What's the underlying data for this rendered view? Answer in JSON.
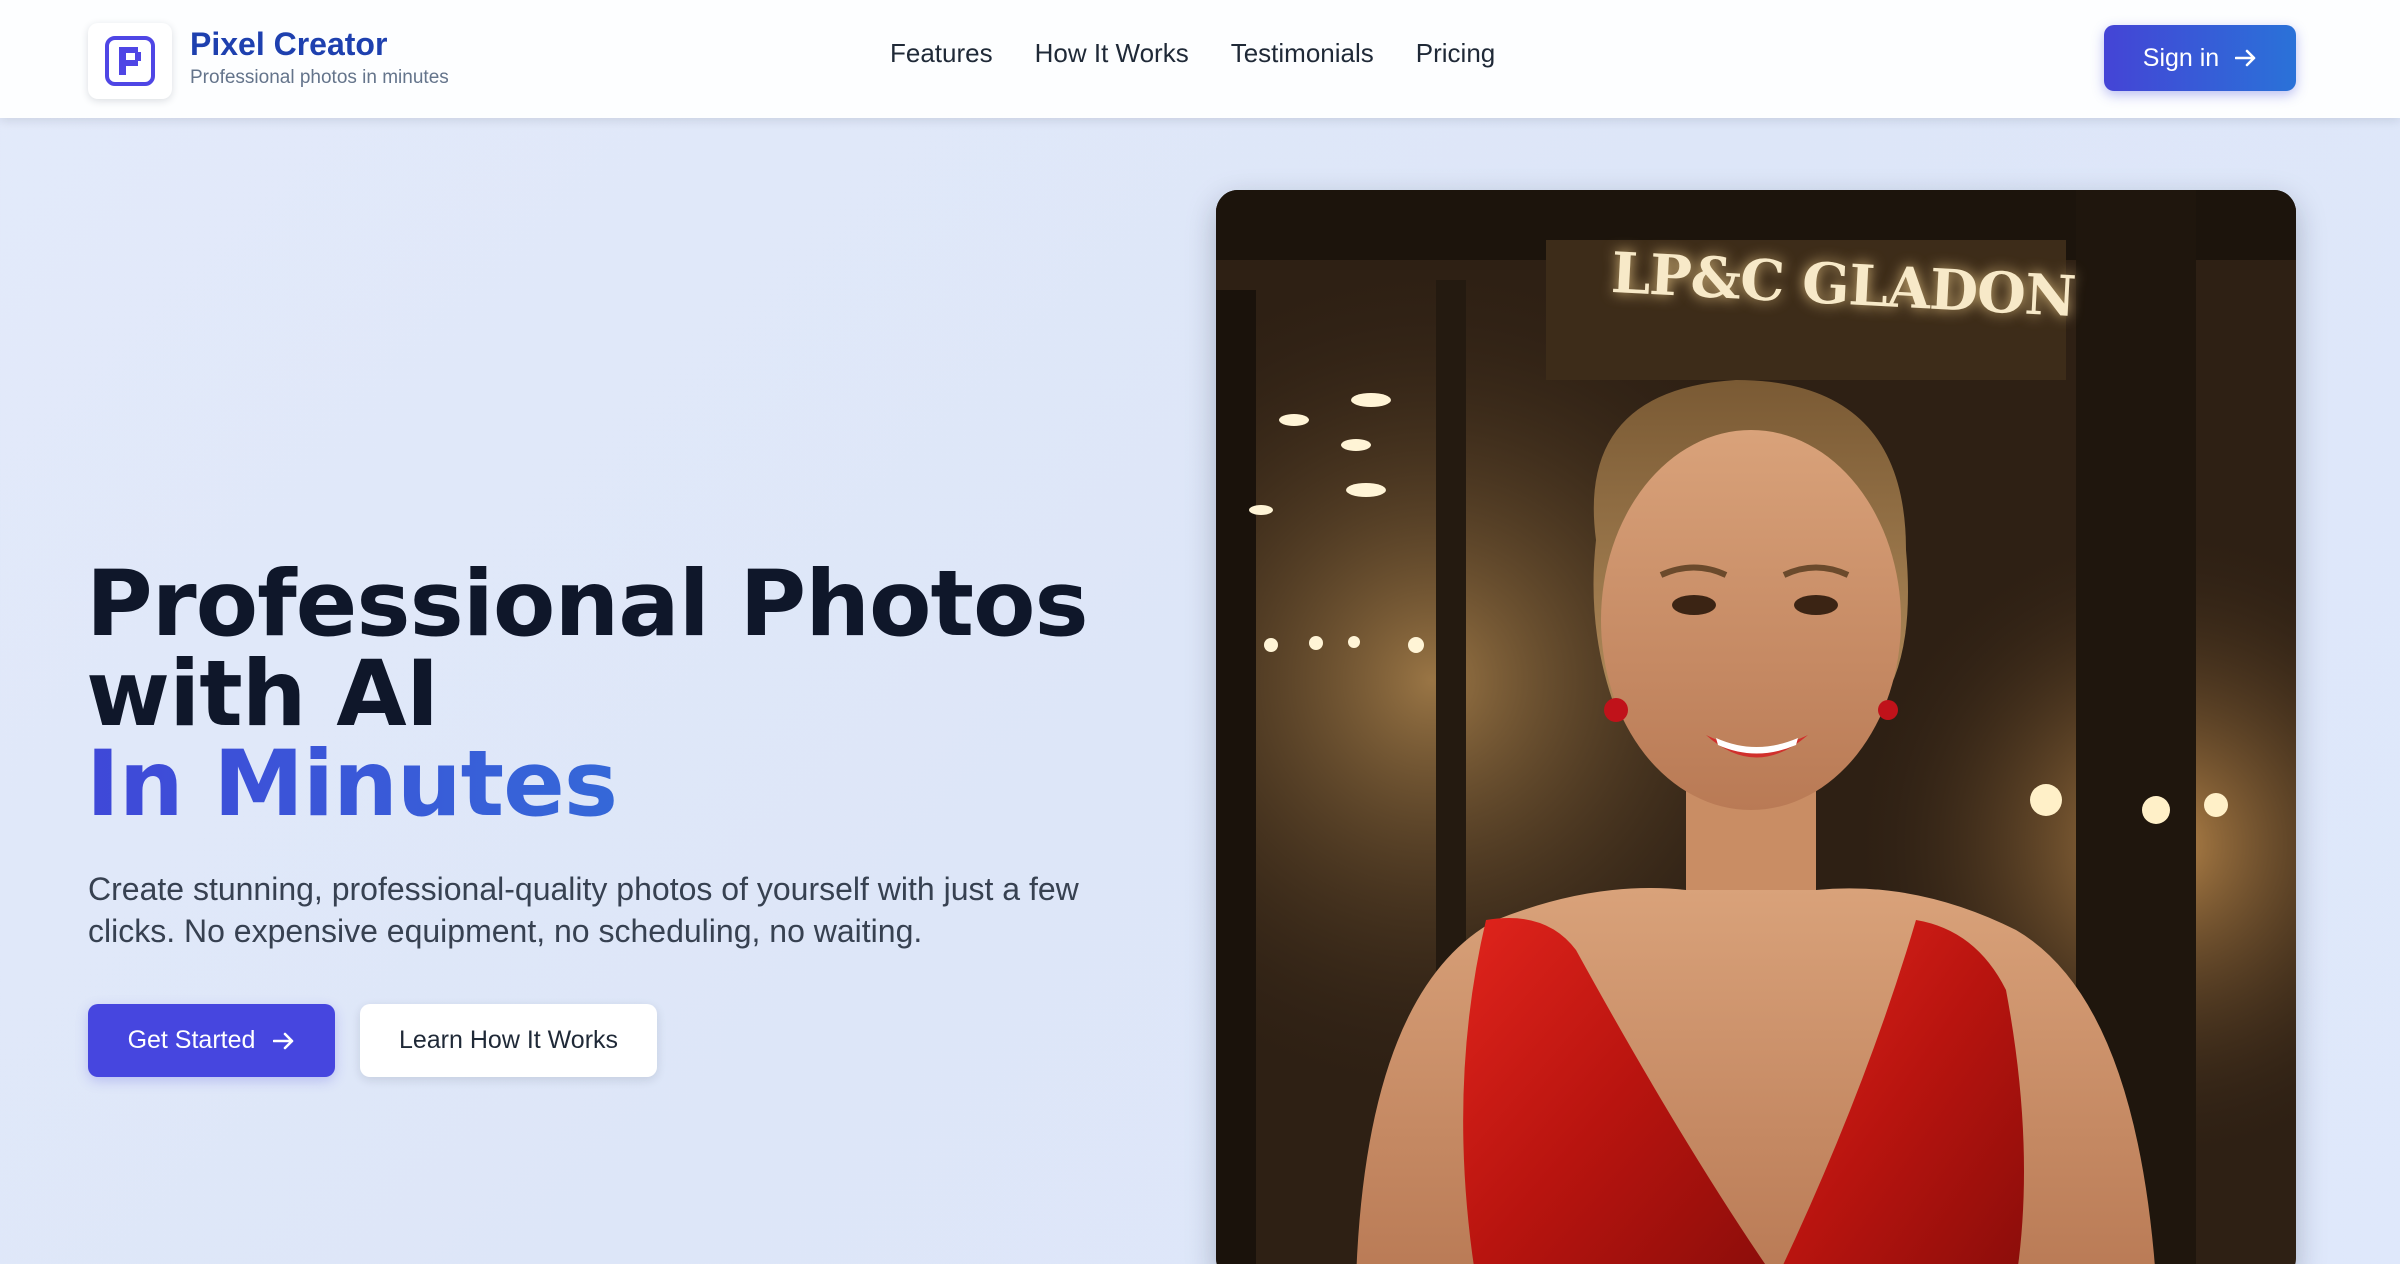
{
  "brand": {
    "name": "Pixel Creator",
    "tagline": "Professional photos in minutes"
  },
  "nav": {
    "items": [
      "Features",
      "How It Works",
      "Testimonials",
      "Pricing"
    ]
  },
  "header": {
    "signin_label": "Sign in"
  },
  "hero": {
    "title_line1": "Professional Photos",
    "title_line2": "with AI",
    "title_accent": "In Minutes",
    "subtitle": "Create stunning, professional-quality photos of yourself with just a few clicks. No expensive equipment, no scheduling, no waiting.",
    "primary_button": "Get Started",
    "secondary_button": "Learn How It Works",
    "image_sign_text": "LP&C GLADON"
  },
  "colors": {
    "brand_blue": "#1e40af",
    "primary": "#4646df",
    "accent_gradient_start": "#3f48d8",
    "accent_gradient_end": "#2a8ad8"
  }
}
